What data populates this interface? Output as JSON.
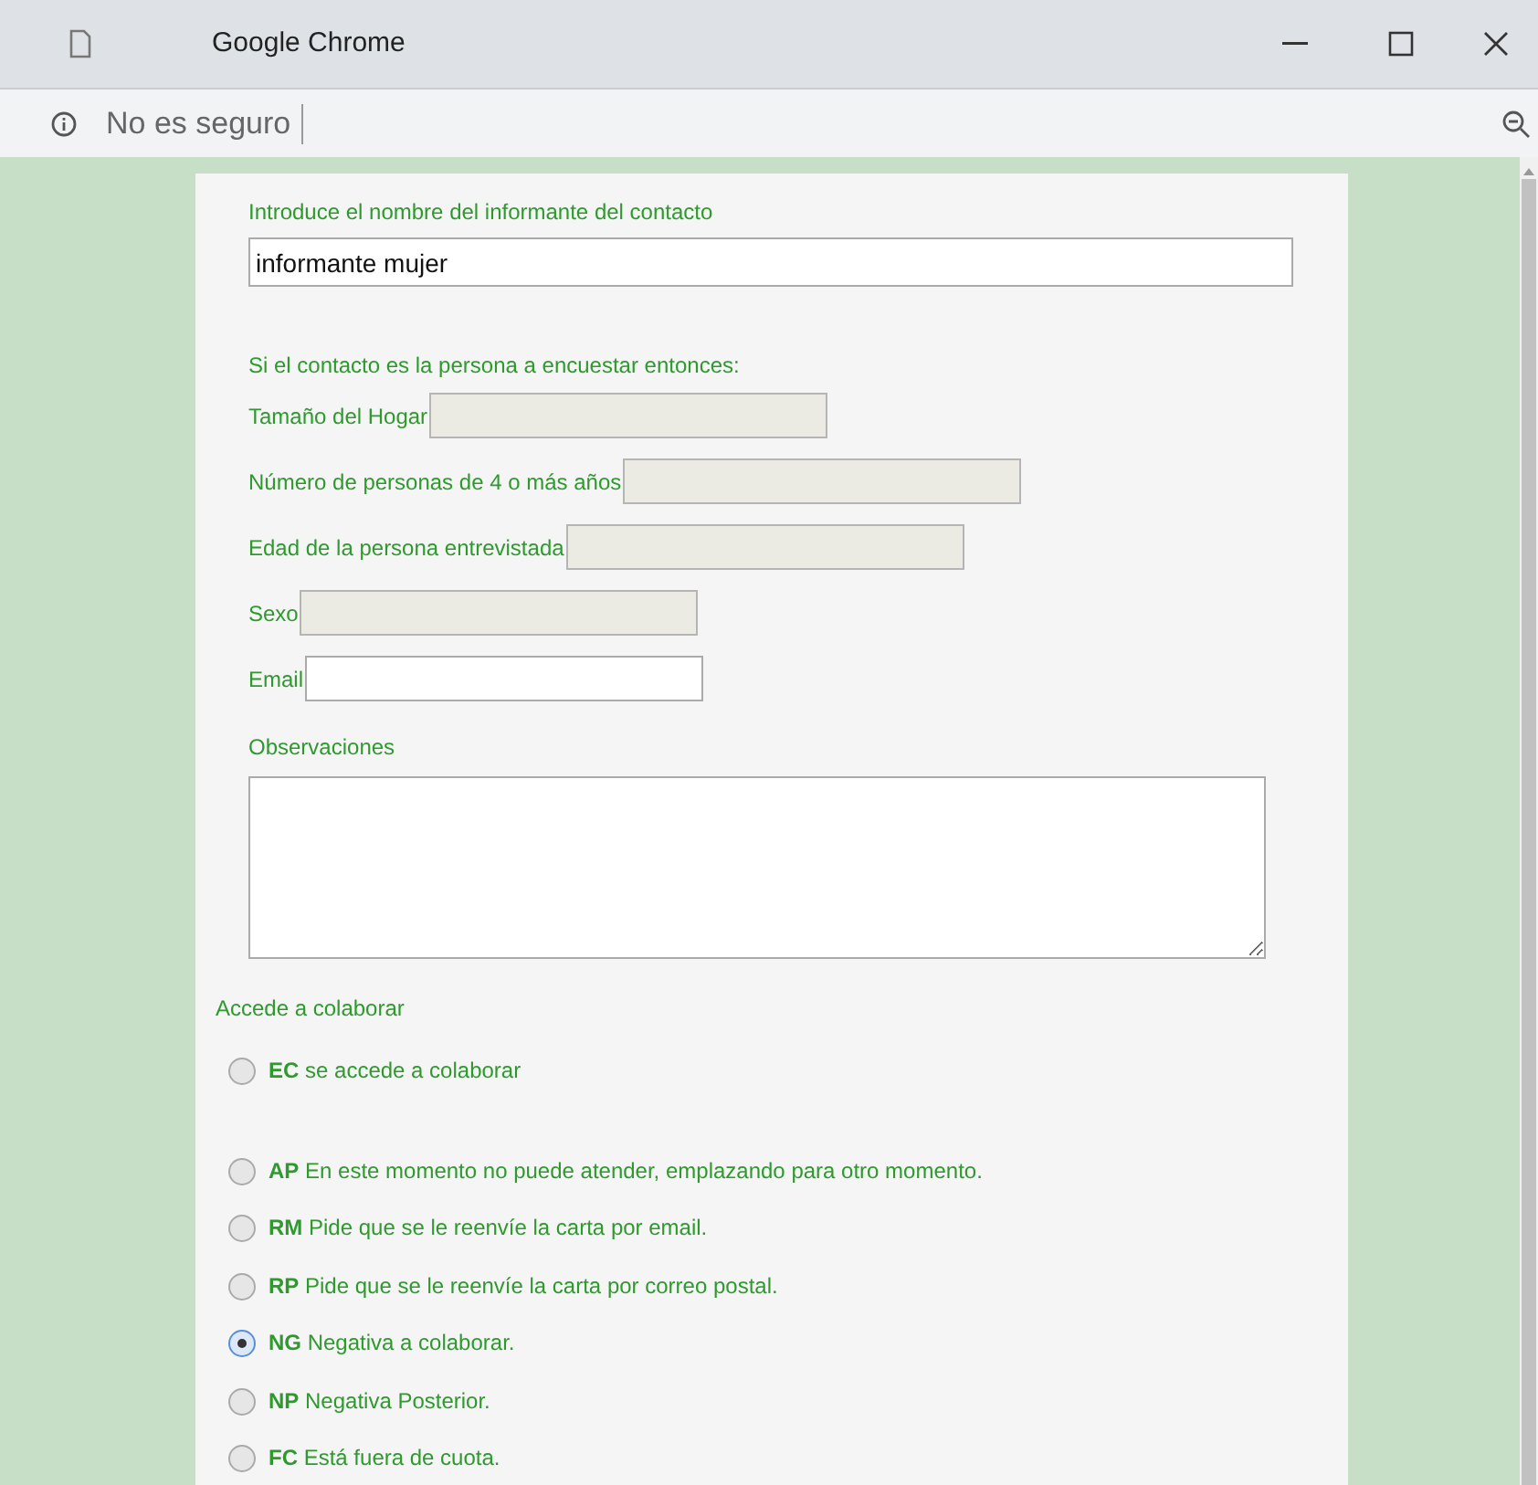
{
  "window": {
    "title": "Google Chrome"
  },
  "address_bar": {
    "security": "No es seguro"
  },
  "form": {
    "name_label": "Introduce el nombre del informante del contacto",
    "name_value": "informante mujer",
    "section_heading": "Si el contacto es la persona a encuestar entonces:",
    "fields": [
      {
        "label": "Tamaño del Hogar",
        "disabled": true
      },
      {
        "label": "Número de personas de 4 o más años",
        "disabled": true
      },
      {
        "label": "Edad de la persona entrevistada",
        "disabled": true
      },
      {
        "label": "Sexo",
        "disabled": true
      },
      {
        "label": "Email",
        "disabled": false
      }
    ],
    "notes_label": "Observaciones",
    "options_heading": "Accede a colaborar",
    "options": [
      {
        "label": "**EC** se accede a colaborar",
        "selected": false
      },
      {
        "label": "**AP** En este momento no puede atender, emplazando para otro momento.",
        "selected": false
      },
      {
        "label": "**RM** Pide que se le reenvíe la carta por email.",
        "selected": false
      },
      {
        "label": "**RP** Pide que se le reenvíe la carta por correo postal.",
        "selected": false
      },
      {
        "label": "**NG** Negativa a colaborar.",
        "selected": true
      },
      {
        "label": "**NP** Negativa Posterior.",
        "selected": false
      },
      {
        "label": "**FC** Está fuera de cuota.",
        "selected": false
      }
    ]
  }
}
